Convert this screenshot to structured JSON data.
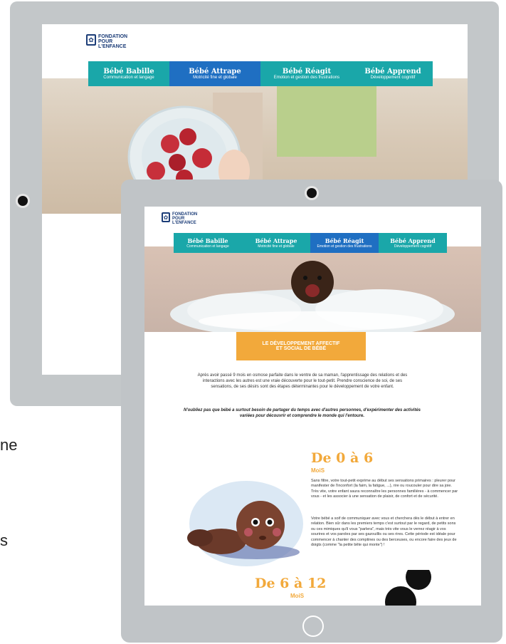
{
  "brand": {
    "line1": "FONDATION",
    "line2": "POUR",
    "line3": "L'ENFANCE"
  },
  "nav": [
    {
      "title": "Bébé Babille",
      "subtitle": "Communication et langage"
    },
    {
      "title": "Bébé Attrape",
      "subtitle": "Motricité fine et globale"
    },
    {
      "title": "Bébé Réagit",
      "subtitle": "Emotion et gestion des frustrations"
    },
    {
      "title": "Bébé Apprend",
      "subtitle": "Développement cognitif"
    }
  ],
  "colors": {
    "teal": "#1aa7a9",
    "blue": "#1f6fc2",
    "orange": "#f2a93b",
    "age": "#f2a93b",
    "navy": "#1c3d78"
  },
  "banner": {
    "line1": "LE DÉVELOPPEMENT AFFECTIF",
    "line2": "ET SOCIAL DE BÉBÉ"
  },
  "intro": "Après avoir passé 9 mois en osmose parfaite dans le ventre de sa maman, l'apprentissage des relations et des interactions avec les autres est une vraie découverte pour le tout-petit. Prendre conscience de soi, de ses sensations, de ses désirs sont des étapes déterminantes pour le développement de votre enfant.",
  "quote": "N'oubliez pas que bébé a surtout besoin de partager du temps avec d'autres personnes, d'expérimenter des activités variées pour découvrir et comprendre le monde qui l'entoure.",
  "section1": {
    "title": "De 0 à 6",
    "unit": "MoiS",
    "p1": "Sans filtre, votre tout-petit exprime au début ses sensations primaires : pleurer pour manifester de l'inconfort (la faim, la fatigue, ...), rire ou roucouler pour dire sa joie. Très vite, votre enfant saura reconnaître les personnes familières - à commencer par vous - et les associer à une sensation de plaisir, de confort et de sécurité.",
    "p2": "Votre bébé a soif de communiquer avec vous et cherchera dès le début à entrer en relation. Bien sûr dans les premiers temps c'est surtout par le regard, de petits sons ou ces mimiques qu'il vous \"parlera\", mais très vite vous le verrez réagir à vos sourires et vos paroles par ses gazouillis ou ses rires. Cette période est idéale pour commencer à chanter des comptines ou des berceuses, ou encore faire des jeux de doigts (comme \"la petite bête qui monte\") !"
  },
  "section2": {
    "title": "De 6 à 12",
    "unit": "MoiS"
  },
  "side": {
    "a": "ne",
    "b": "s"
  }
}
